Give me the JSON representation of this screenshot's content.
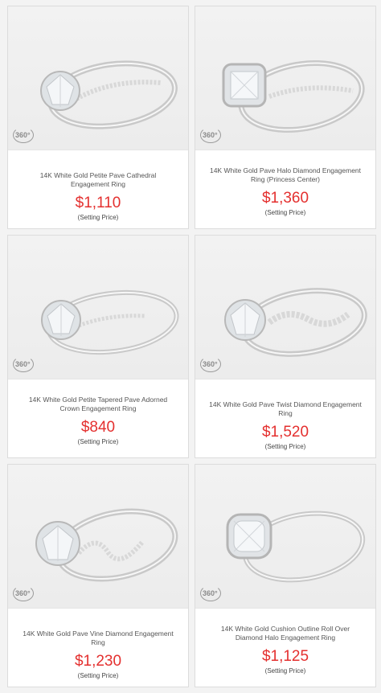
{
  "badge_text": "360°",
  "price_color": "#e4302f",
  "cards": [
    {
      "title": "14K White Gold Petite Pave Cathedral Engagement Ring",
      "price": "$1,110",
      "note": "(Setting Price)"
    },
    {
      "title": "14K White Gold Pave Halo Diamond Engagement Ring (Princess Center)",
      "price": "$1,360",
      "note": "(Setting Price)"
    },
    {
      "title": "14K White Gold Petite Tapered Pave Adorned Crown Engagement Ring",
      "price": "$840",
      "note": "(Setting Price)"
    },
    {
      "title": "14K White Gold Pave Twist Diamond Engagement Ring",
      "price": "$1,520",
      "note": "(Setting Price)"
    },
    {
      "title": "14K White Gold Pave Vine Diamond Engagement Ring",
      "price": "$1,230",
      "note": "(Setting Price)"
    },
    {
      "title": "14K White Gold Cushion Outline Roll Over Diamond Halo Engagement Ring",
      "price": "$1,125",
      "note": "(Setting Price)"
    }
  ]
}
